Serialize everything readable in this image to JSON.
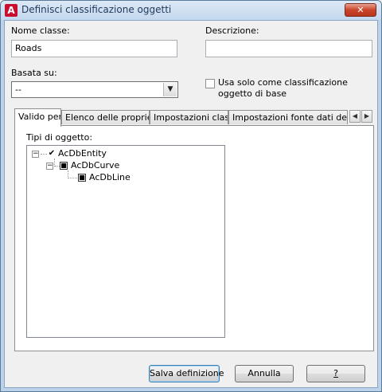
{
  "window": {
    "title": "Definisci classificazione oggetti",
    "close_label": "✕"
  },
  "form": {
    "class_name_label": "Nome classe:",
    "class_name_value": "Roads",
    "description_label": "Descrizione:",
    "description_value": "",
    "based_on_label": "Basata su:",
    "based_on_value": "--",
    "base_only_label": "Usa solo come classificazione oggetto di base",
    "base_only_checked": false
  },
  "tabs": [
    {
      "label": "Valido per",
      "active": true
    },
    {
      "label": "Elenco delle proprietà",
      "active": false
    },
    {
      "label": "Impostazioni classe",
      "active": false
    },
    {
      "label": "Impostazioni fonte dati dell'oggetto",
      "active": false
    }
  ],
  "valid_for": {
    "object_types_label": "Tipi di oggetto:",
    "tree": [
      {
        "label": "AcDbEntity",
        "level": 0,
        "expanded": true,
        "check": "checked"
      },
      {
        "label": "AcDbCurve",
        "level": 1,
        "expanded": true,
        "check": "partial"
      },
      {
        "label": "AcDbLine",
        "level": 2,
        "expanded": false,
        "check": "partial"
      }
    ]
  },
  "buttons": {
    "save": "Salva definizione",
    "cancel": "Annulla",
    "help": "?"
  },
  "icons": {
    "app": "autocad-logo-icon",
    "combo_arrow": "chevron-down-icon",
    "tab_left": "arrow-left-icon",
    "tab_right": "arrow-right-icon"
  }
}
